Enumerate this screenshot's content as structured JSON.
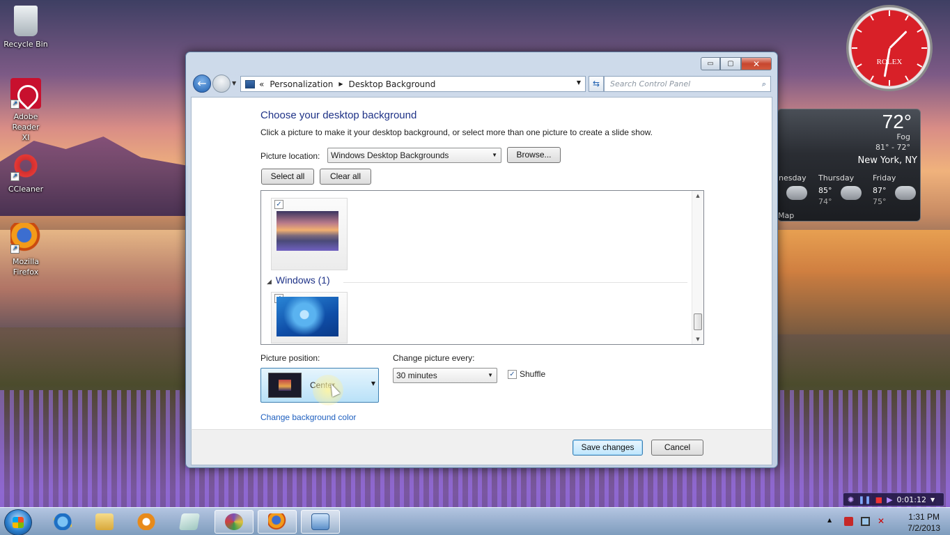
{
  "desktop": {
    "icons": [
      {
        "label": "Recycle Bin"
      },
      {
        "label": "Adobe Reader XI"
      },
      {
        "label": "CCleaner"
      },
      {
        "label": "Mozilla Firefox"
      }
    ]
  },
  "clock_gadget": {
    "brand": "ROLEX"
  },
  "weather_gadget": {
    "temp": "72°",
    "condition": "Fog",
    "range": "81° - 72°",
    "city": "New York, NY",
    "days": [
      {
        "name": "dnesday",
        "hi": "",
        "lo": ""
      },
      {
        "name": "Thursday",
        "hi": "85°",
        "lo": "74°"
      },
      {
        "name": "Friday",
        "hi": "87°",
        "lo": "75°"
      }
    ],
    "map_link": "Map"
  },
  "window": {
    "buttons": {
      "minimize": "▭",
      "maximize": "▢",
      "close": "✕"
    },
    "breadcrumb": {
      "prefix": "«",
      "items": [
        "Personalization",
        "Desktop Background"
      ]
    },
    "search_placeholder": "Search Control Panel",
    "title": "Choose your desktop background",
    "subtitle": "Click a picture to make it your desktop background, or select more than one picture to create a slide show.",
    "picture_location_label": "Picture location:",
    "picture_location_value": "Windows Desktop Backgrounds",
    "browse_label": "Browse...",
    "select_all_label": "Select all",
    "clear_all_label": "Clear all",
    "group_header": "Windows (1)",
    "picture_position_label": "Picture position:",
    "picture_position_value": "Center",
    "change_every_label": "Change picture every:",
    "change_every_value": "30 minutes",
    "shuffle_label": "Shuffle",
    "change_bg_color_link": "Change background color",
    "save_label": "Save changes",
    "cancel_label": "Cancel"
  },
  "media_overlay": {
    "time": "0:01:12"
  },
  "taskbar": {
    "time": "1:31 PM",
    "date": "7/2/2013"
  },
  "colors": {
    "accent_blue": "#1e3287",
    "link": "#1e5fbf",
    "clock_red": "#d82028"
  }
}
